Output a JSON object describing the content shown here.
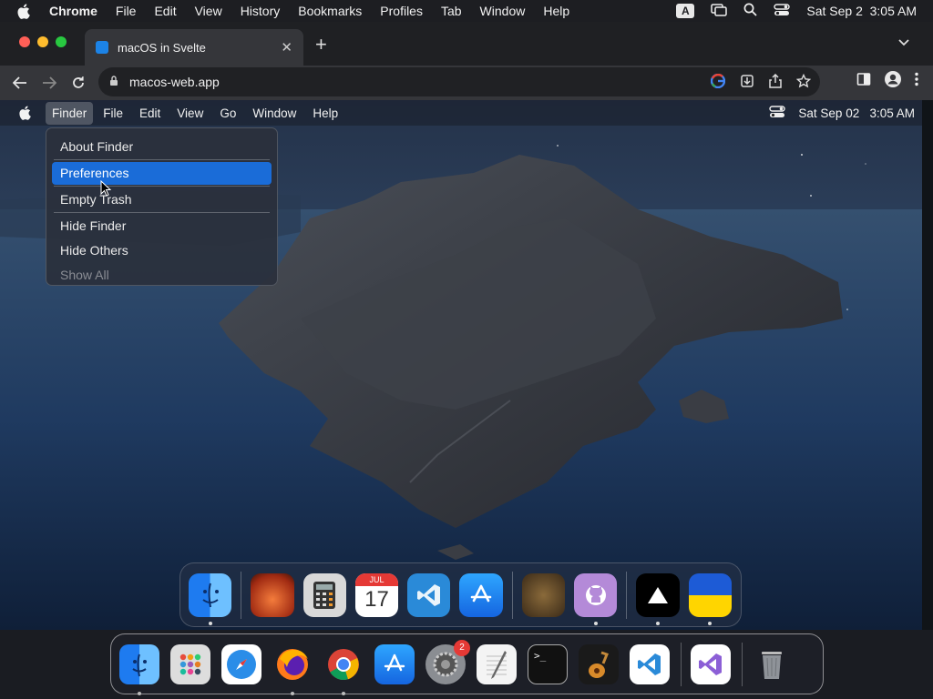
{
  "system_menubar": {
    "app_name": "Chrome",
    "menus": [
      "File",
      "Edit",
      "View",
      "History",
      "Bookmarks",
      "Profiles",
      "Tab",
      "Window",
      "Help"
    ],
    "input_indicator": "A",
    "datetime": "Sat Sep 2  3:05 AM"
  },
  "browser": {
    "tab_title": "macOS in Svelte",
    "url": "macos-web.app"
  },
  "web_menubar": {
    "menus": [
      "Finder",
      "File",
      "Edit",
      "View",
      "Go",
      "Window",
      "Help"
    ],
    "active_menu": "Finder",
    "datetime": "Sat Sep 02   3:05 AM"
  },
  "finder_menu": {
    "items": [
      {
        "label": "About Finder"
      },
      {
        "label": "Preferences",
        "selected": true
      },
      {
        "label": "Empty Trash"
      },
      {
        "label": "Hide Finder"
      },
      {
        "label": "Hide Others"
      },
      {
        "label": "Show All",
        "disabled": true
      }
    ]
  },
  "web_dock": {
    "apps": [
      "finder-icon",
      "wallpapers-icon",
      "calculator-icon",
      "calendar-icon",
      "vscode-icon",
      "appstore-icon",
      "purrtrait-icon",
      "github-icon",
      "vercel-icon",
      "ukraine-icon"
    ],
    "calendar_month": "JUL",
    "calendar_day": "17"
  },
  "mac_dock": {
    "apps": [
      "finder-icon",
      "launchpad-icon",
      "safari-icon",
      "firefox-icon",
      "chrome-icon",
      "appstore-icon",
      "settings-icon",
      "textedit-icon",
      "terminal-icon",
      "garageband-icon",
      "vscode-icon",
      "visualstudio-icon",
      "trash-icon"
    ],
    "settings_badge": "2",
    "terminal_prompt": ">_"
  },
  "colors": {
    "accent": "#1a6cd8",
    "traffic_red": "#ff5f57",
    "traffic_yellow": "#febc2e",
    "traffic_green": "#28c840"
  }
}
